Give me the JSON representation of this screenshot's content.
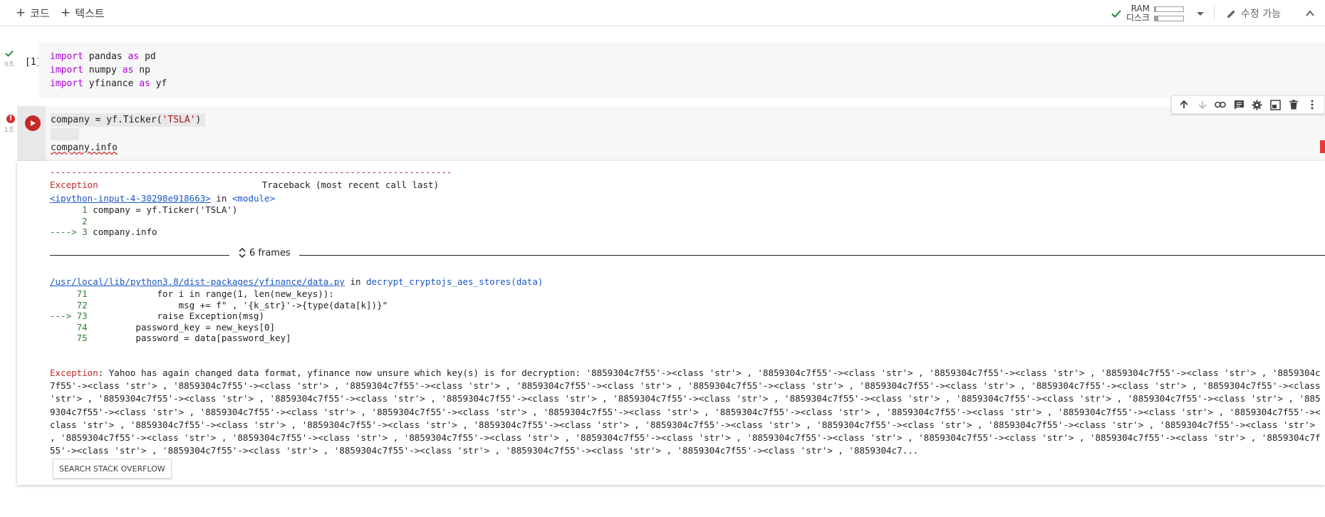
{
  "toolbar": {
    "add_code": "코드",
    "add_text": "텍스트",
    "ram_label": "RAM",
    "disk_label": "디스크",
    "edit_label": "수정 가능",
    "ram_usage": 0.05,
    "disk_usage": 0.12
  },
  "cell1": {
    "exec_count": "[1]",
    "status_time": "0초",
    "lines": [
      {
        "kw": "import",
        "rest": " pandas ",
        "kw2": "as",
        "rest2": " pd"
      },
      {
        "kw": "import",
        "rest": " numpy ",
        "kw2": "as",
        "rest2": " np"
      },
      {
        "kw": "import",
        "rest": " yfinance ",
        "kw2": "as",
        "rest2": " yf"
      }
    ]
  },
  "cell2": {
    "status_time": "1초",
    "line1_pre": "company = yf.Ticker(",
    "line1_str": "'TSLA'",
    "line1_post": ")",
    "line3": "company.info"
  },
  "output": {
    "dashes": "---------------------------------------------------------------------------",
    "exception_name": "Exception",
    "traceback_header": "Traceback (most recent call last)",
    "input_link": "<ipython-input-4-30298e918663>",
    "in_word": " in ",
    "module": "<module>",
    "tb1": [
      {
        "num": "      1",
        "code": " company = yf.Ticker('TSLA')"
      },
      {
        "num": "      2",
        "code": ""
      },
      {
        "num": "----> 3",
        "code": " company.info"
      }
    ],
    "frames_label": "6 frames",
    "file_link": "/usr/local/lib/python3.8/dist-packages/yfinance/data.py",
    "func_name": "decrypt_cryptojs_aes_stores(data)",
    "tb2": [
      {
        "num": "     71",
        "code": "             for i in range(1, len(new_keys)):"
      },
      {
        "num": "     72",
        "code": "                 msg += f\" , '{k_str}'->{type(data[k])}\""
      },
      {
        "num": "---> 73",
        "code": "             raise Exception(msg)"
      },
      {
        "num": "     74",
        "code": "         password_key = new_keys[0]"
      },
      {
        "num": "     75",
        "code": "         password = data[password_key]"
      }
    ],
    "error_label": "Exception",
    "error_message": ": Yahoo has again changed data format, yfinance now unsure which key(s) is for decryption: '8859304c7f55'-><class 'str'> , '8859304c7f55'-><class 'str'> , '8859304c7f55'-><class 'str'> , '8859304c7f55'-><class 'str'> , '8859304c7f55'-><class 'str'> , '8859304c7f55'-><class 'str'> , '8859304c7f55'-><class 'str'> , '8859304c7f55'-><class 'str'> , '8859304c7f55'-><class 'str'> , '8859304c7f55'-><class 'str'> , '8859304c7f55'-><class 'str'> , '8859304c7f55'-><class 'str'> , '8859304c7f55'-><class 'str'> , '8859304c7f55'-><class 'str'> , '8859304c7f55'-><class 'str'> , '8859304c7f55'-><class 'str'> , '8859304c7f55'-><class 'str'> , '8859304c7f55'-><class 'str'> , '8859304c7f55'-><class 'str'> , '8859304c7f55'-><class 'str'> , '8859304c7f55'-><class 'str'> , '8859304c7f55'-><class 'str'> , '8859304c7f55'-><class 'str'> , '8859304c7f55'-><class 'str'> , '8859304c7f55'-><class 'str'> , '8859304c7f55'-><class 'str'> , '8859304c7f55'-><class 'str'> , '8859304c7f55'-><class 'str'> , '8859304c7f55'-><class 'str'> , '8859304c7f55'-><class 'str'> , '8859304c7f55'-><class 'str'> , '8859304c7f55'-><class 'str'> , '8859304c7f55'-><class 'str'> , '8859304c7f55'-><class 'str'> , '8859304c7f55'-><class 'str'> , '8859304c7f55'-><class 'str'> , '8859304c7f55'-><class 'str'> , '8859304c7f55'-><class 'str'> , '8859304c7f55'-><class 'str'> , '8859304c7f55'-><class 'str'> , '8859304c7f55'-><class 'str'> , '8859304c7f55'-><class 'str'> , '8859304c7f55'-><class 'str'> , '8859304c7f55'-><class 'str'> , '8859304c7f55'-><class 'str'> , '8859304c7f55'-><class 'str'> , '8859304c7...",
    "so_button": "SEARCH STACK OVERFLOW"
  }
}
